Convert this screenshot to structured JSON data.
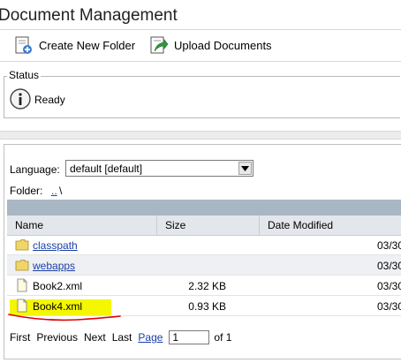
{
  "header": {
    "title": "Document Management"
  },
  "toolbar": {
    "create_folder_label": "Create New Folder",
    "upload_label": "Upload Documents"
  },
  "status": {
    "legend": "Status",
    "text": "Ready"
  },
  "language": {
    "label": "Language:",
    "selected": "default [default]"
  },
  "folder": {
    "label": "Folder:",
    "link": "..",
    "separator": "\\"
  },
  "table": {
    "columns": [
      "Name",
      "Size",
      "Date Modified"
    ],
    "rows": [
      {
        "name": "classpath",
        "type": "folder",
        "size": "",
        "date": "03/30"
      },
      {
        "name": "webapps",
        "type": "folder",
        "size": "",
        "date": "03/30"
      },
      {
        "name": "Book2.xml",
        "type": "file",
        "size": "2.32 KB",
        "date": "03/30"
      },
      {
        "name": "Book4.xml",
        "type": "file",
        "size": "0.93 KB",
        "date": "03/30"
      }
    ]
  },
  "pager": {
    "first": "First",
    "previous": "Previous",
    "next": "Next",
    "last": "Last",
    "page_label": "Page",
    "page_value": "1",
    "of_label": "of 1"
  },
  "colors": {
    "link": "#1a3fa8",
    "highlight": "#f4f700",
    "annotation": "#e00000",
    "table_bar": "#a9b6c4"
  },
  "icons": {
    "create_folder": "new-folder-icon",
    "upload": "upload-icon",
    "status": "info-icon",
    "folder": "folder-icon",
    "file": "file-icon"
  }
}
